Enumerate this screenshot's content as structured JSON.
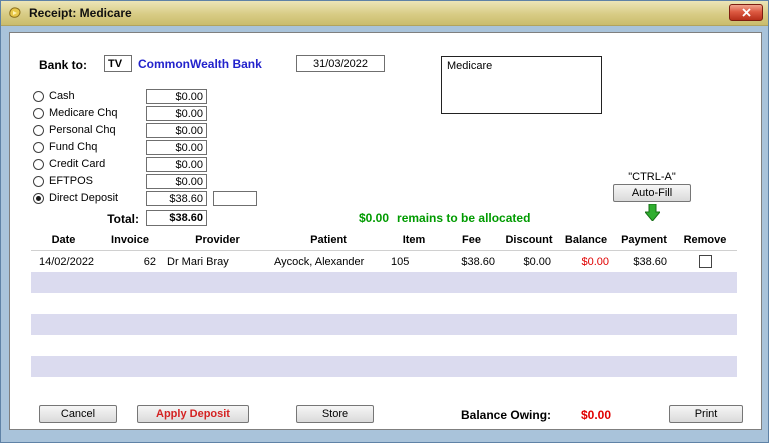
{
  "window": {
    "title": "Receipt: Medicare"
  },
  "bank": {
    "label": "Bank to:",
    "code": "TV",
    "name": "CommonWealth Bank",
    "date": "31/03/2022",
    "memo": "Medicare"
  },
  "payment_methods": [
    {
      "label": "Cash",
      "amount": "$0.00",
      "selected": false
    },
    {
      "label": "Medicare Chq",
      "amount": "$0.00",
      "selected": false
    },
    {
      "label": "Personal Chq",
      "amount": "$0.00",
      "selected": false
    },
    {
      "label": "Fund Chq",
      "amount": "$0.00",
      "selected": false
    },
    {
      "label": "Credit Card",
      "amount": "$0.00",
      "selected": false
    },
    {
      "label": "EFTPOS",
      "amount": "$0.00",
      "selected": false
    },
    {
      "label": "Direct Deposit",
      "amount": "$38.60",
      "selected": true,
      "extra_value": ""
    }
  ],
  "totals": {
    "label": "Total:",
    "value": "$38.60"
  },
  "allocation": {
    "amount": "$0.00",
    "text": "remains to be allocated"
  },
  "autofill": {
    "shortcut": "\"CTRL-A\"",
    "button_label": "Auto-Fill"
  },
  "table": {
    "columns": [
      "Date",
      "Invoice",
      "Provider",
      "Patient",
      "Item",
      "Fee",
      "Discount",
      "Balance",
      "Payment",
      "Remove"
    ],
    "rows": [
      {
        "date": "14/02/2022",
        "invoice": "62",
        "provider": "Dr Mari Bray",
        "patient": "Aycock, Alexander",
        "item": "105",
        "fee": "$38.60",
        "discount": "$0.00",
        "balance": "$0.00",
        "payment": "$38.60",
        "remove_checked": false
      }
    ],
    "empty_row_count": 6
  },
  "footer": {
    "cancel_label": "Cancel",
    "apply_deposit_label": "Apply Deposit",
    "store_label": "Store",
    "balance_owing_label": "Balance Owing:",
    "balance_owing_value": "$0.00",
    "print_label": "Print"
  },
  "colors": {
    "titlebar_gold": "#d8cc85",
    "window_blue": "#a9c3da",
    "bank_name_blue": "#2222cc",
    "allocation_green": "#009b00",
    "negative_red": "#e00000",
    "row_stripe": "#dbdbef"
  }
}
